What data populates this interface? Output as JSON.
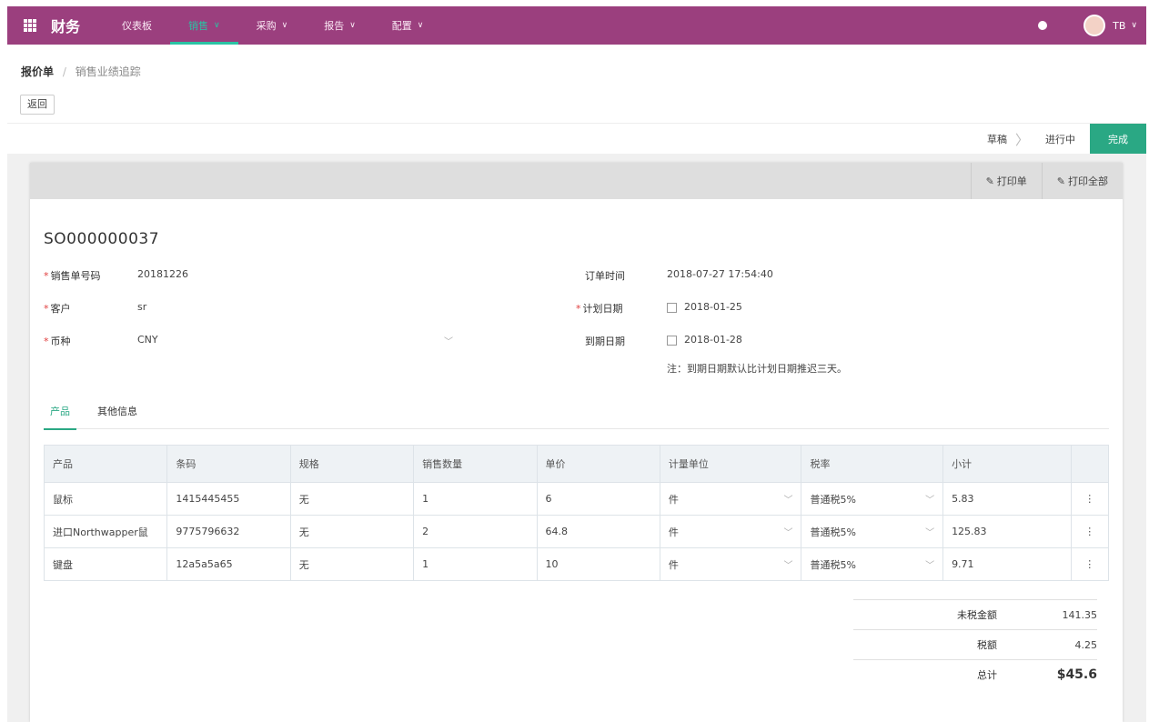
{
  "app": {
    "brand": "财务"
  },
  "nav": [
    {
      "label": "仪表板",
      "has_caret": false
    },
    {
      "label": "销售",
      "has_caret": true
    },
    {
      "label": "采购",
      "has_caret": true
    },
    {
      "label": "报告",
      "has_caret": true
    },
    {
      "label": "配置",
      "has_caret": true
    }
  ],
  "user": {
    "name": "TB"
  },
  "breadcrumb": {
    "root": "报价单",
    "sep": "/",
    "current": "销售业绩追踪"
  },
  "actions": {
    "back_label": "返回"
  },
  "stages": [
    "草稿",
    "进行中",
    "完成"
  ],
  "card_actions": [
    "打印单",
    "打印全部"
  ],
  "doc": {
    "number": "SO000000037"
  },
  "fields": {
    "order_name_label": "销售单号码",
    "order_name_value": "20181226",
    "customer_label": "客户",
    "customer_value": "sr",
    "currency_label": "币种",
    "currency_value": "CNY",
    "order_date_label": "订单时间",
    "order_date_value": "2018-07-27 17:54:40",
    "plan_date_label": "计划日期",
    "plan_date_value": "2018-01-25",
    "expire_date_label": "到期日期",
    "expire_date_value": "2018-01-28",
    "note": "注：到期日期默认比计划日期推迟三天。"
  },
  "tabs": [
    "产品",
    "其他信息"
  ],
  "table": {
    "headers": [
      "产品",
      "条码",
      "规格",
      "销售数量",
      "单价",
      "计量单位",
      "税率",
      "小计"
    ],
    "rows": [
      {
        "product": "鼠标",
        "barcode": "1415445455",
        "spec": "无",
        "qty": "1",
        "price": "6",
        "unit": "件",
        "tax": "普通税5%",
        "subtotal": "5.83"
      },
      {
        "product": "进口Northwapper鼠",
        "barcode": "9775796632",
        "spec": "无",
        "qty": "2",
        "price": "64.8",
        "unit": "件",
        "tax": "普通税5%",
        "subtotal": "125.83"
      },
      {
        "product": "键盘",
        "barcode": "12a5a5a65",
        "spec": "无",
        "qty": "1",
        "price": "10",
        "unit": "件",
        "tax": "普通税5%",
        "subtotal": "9.71"
      }
    ]
  },
  "totals": {
    "untaxed_label": "未税金额",
    "untaxed_value": "141.35",
    "tax_label": "税额",
    "tax_value": "4.25",
    "total_label": "总计",
    "total_value": "$45.6"
  }
}
